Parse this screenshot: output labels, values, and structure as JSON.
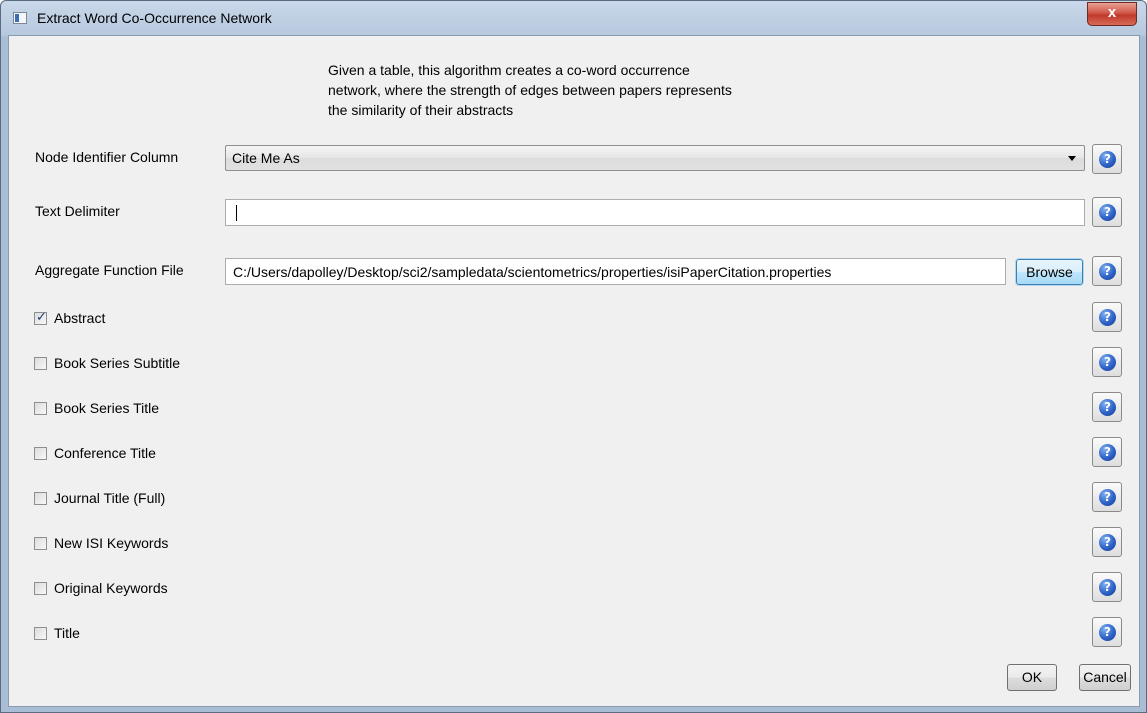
{
  "window": {
    "title": "Extract Word Co-Occurrence Network",
    "close_label": "x"
  },
  "description": [
    "Given a table, this algorithm creates a co-word occurrence",
    "network, where the strength of edges between papers represents",
    "the similarity of their abstracts"
  ],
  "node_identifier": {
    "label": "Node Identifier Column",
    "value": "Cite Me As"
  },
  "text_delimiter": {
    "label": "Text Delimiter",
    "value": ""
  },
  "aggregate_file": {
    "label": "Aggregate Function File",
    "value": "C:/Users/dapolley/Desktop/sci2/sampledata/scientometrics/properties/isiPaperCitation.properties",
    "browse_label": "Browse"
  },
  "fields": [
    {
      "label": "Abstract",
      "checked": true
    },
    {
      "label": "Book Series Subtitle",
      "checked": false
    },
    {
      "label": "Book Series Title",
      "checked": false
    },
    {
      "label": "Conference Title",
      "checked": false
    },
    {
      "label": "Journal Title (Full)",
      "checked": false
    },
    {
      "label": "New ISI Keywords",
      "checked": false
    },
    {
      "label": "Original Keywords",
      "checked": false
    },
    {
      "label": "Title",
      "checked": false
    }
  ],
  "help_icon": "help-question-icon",
  "buttons": {
    "ok": "OK",
    "cancel": "Cancel"
  }
}
